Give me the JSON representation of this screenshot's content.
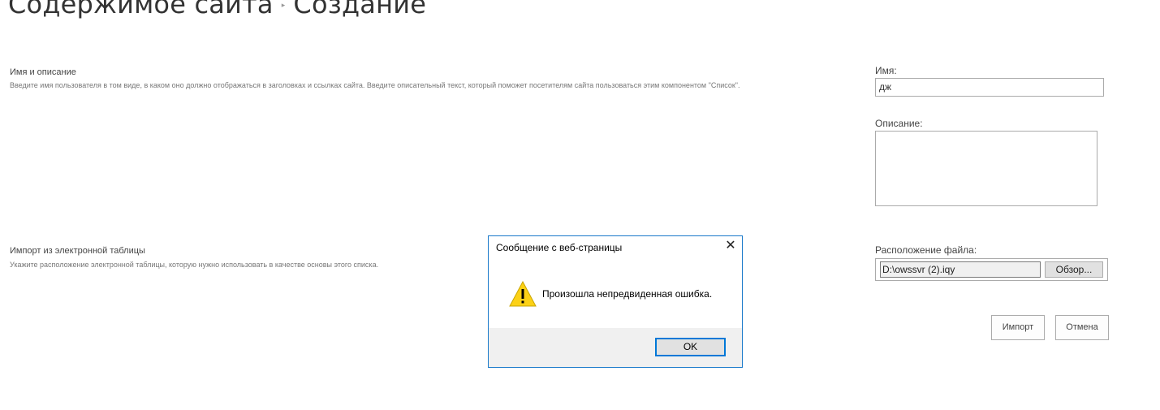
{
  "breadcrumb": {
    "parent": "Содержимое сайта",
    "separator": "▸",
    "current": "Создание"
  },
  "sections": {
    "name_desc": {
      "heading": "Имя и описание",
      "description": "Введите имя пользователя в том виде, в каком оно должно отображаться в заголовках и ссылках сайта. Введите описательный текст, который поможет посетителям сайта пользоваться этим компонентом \"Список\"."
    },
    "import": {
      "heading": "Импорт из электронной таблицы",
      "description": "Укажите расположение электронной таблицы, которую нужно использовать в качестве основы этого списка."
    }
  },
  "form": {
    "name_label": "Имя:",
    "name_value": "дж",
    "description_label": "Описание:",
    "description_value": "",
    "file_label": "Расположение файла:",
    "file_value": "D:\\owssvr (2).iqy",
    "browse_label": "Обзор..."
  },
  "actions": {
    "import_label": "Импорт",
    "cancel_label": "Отмена"
  },
  "dialog": {
    "title": "Сообщение с веб-страницы",
    "close_symbol": "✕",
    "message": "Произошла непредвиденная ошибка.",
    "ok_label": "OK",
    "icon": "warning-icon"
  },
  "colors": {
    "dialog_border": "#1979ca",
    "ok_focus": "#0078d7",
    "warning_fill": "#fcd116"
  }
}
